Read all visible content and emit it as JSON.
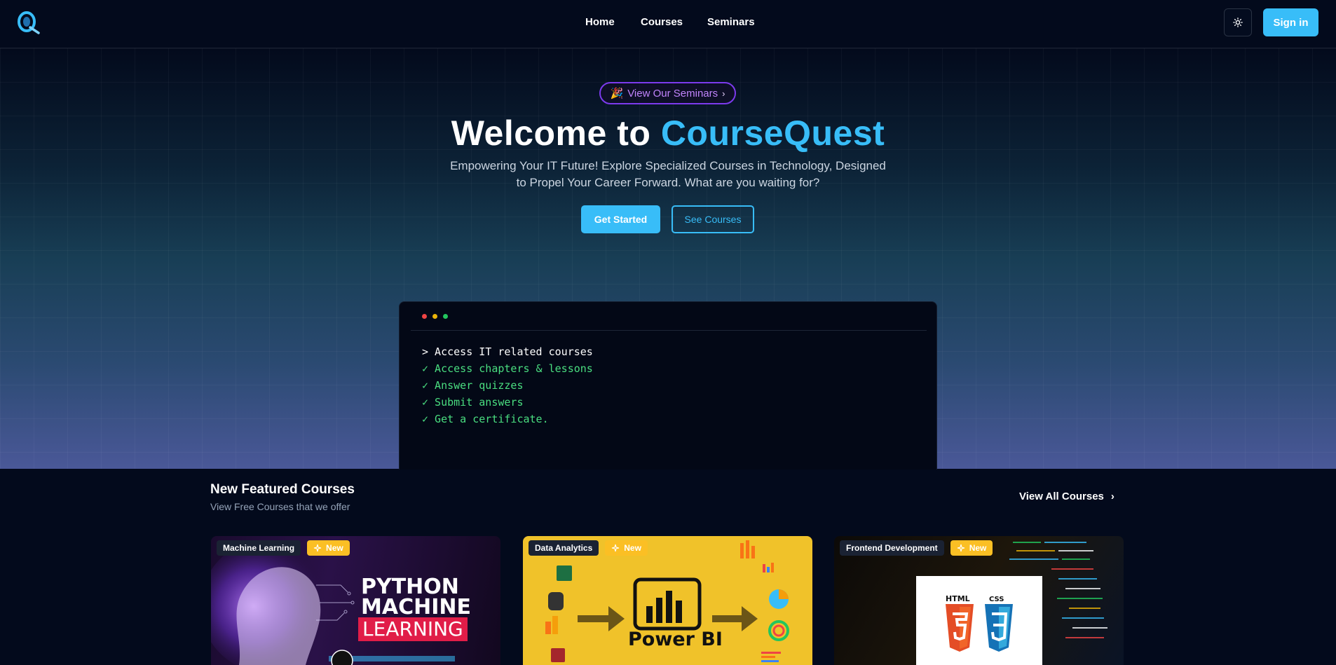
{
  "nav": {
    "links": [
      "Home",
      "Courses",
      "Seminars"
    ],
    "signin_label": "Sign in",
    "theme_icon": "sun-icon",
    "logo_icon": "coursequest-logo"
  },
  "hero": {
    "pill_emoji": "🎉",
    "pill_label": "View Our Seminars",
    "title_prefix": "Welcome to ",
    "title_brand": "CourseQuest",
    "subtitle": "Empowering Your IT Future! Explore Specialized Courses in Technology, Designed to Propel Your Career Forward. What are you waiting for?",
    "primary_label": "Get Started",
    "secondary_label": "See Courses"
  },
  "terminal": {
    "lines": [
      {
        "kind": "cmd",
        "text": "> Access IT related courses"
      },
      {
        "kind": "ok",
        "text": "✓ Access chapters & lessons"
      },
      {
        "kind": "ok",
        "text": "✓ Answer quizzes"
      },
      {
        "kind": "ok",
        "text": "✓ Submit answers"
      },
      {
        "kind": "ok",
        "text": "✓ Get a certificate."
      }
    ],
    "dot_colors": [
      "#ef4444",
      "#eab308",
      "#22c55e"
    ]
  },
  "featured": {
    "title": "New Featured Courses",
    "subtitle": "View Free Courses that we offer",
    "view_all_label": "View All Courses",
    "courses": [
      {
        "category": "Machine Learning",
        "badge": "New",
        "art_lines": [
          "PYTHON",
          "MACHINE"
        ],
        "art_highlight": "LEARNING"
      },
      {
        "category": "Data Analytics",
        "badge": "New",
        "art_text": "Power BI"
      },
      {
        "category": "Frontend Development",
        "badge": "New",
        "art_labels": [
          "HTML",
          "CSS"
        ]
      }
    ]
  },
  "colors": {
    "accent": "#38bdf8",
    "pill_border": "#7c3aed",
    "pill_text": "#c084fc",
    "success": "#4ade80",
    "new_badge": "#fbbf24"
  }
}
